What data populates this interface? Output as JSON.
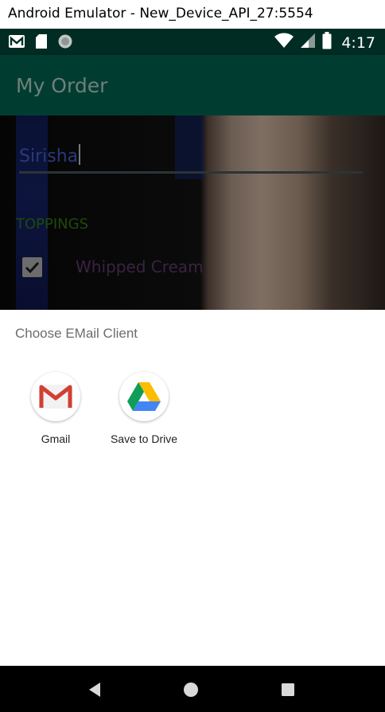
{
  "window": {
    "title": "Android Emulator - New_Device_API_27:5554"
  },
  "statusbar": {
    "time": "4:17",
    "icons": [
      "gmail-notification-icon",
      "sd-card-icon",
      "sync-icon",
      "wifi-icon",
      "cell-signal-icon",
      "battery-icon"
    ]
  },
  "appbar": {
    "title": "My Order"
  },
  "form": {
    "name_value": "Sirisha",
    "section_label": "TOPPINGS",
    "topping_label": "Whipped Cream",
    "topping_checked": true
  },
  "chooser": {
    "title": "Choose EMail Client",
    "apps": [
      {
        "label": "Gmail",
        "icon": "gmail-icon"
      },
      {
        "label": "Save to Drive",
        "icon": "google-drive-icon"
      }
    ]
  },
  "navigation": {
    "buttons": [
      "back-icon",
      "home-icon",
      "recents-icon"
    ]
  },
  "colors": {
    "statusbar": "#002c23",
    "appbar": "#003d30",
    "sheet": "#ffffff",
    "navbar": "#000000"
  }
}
